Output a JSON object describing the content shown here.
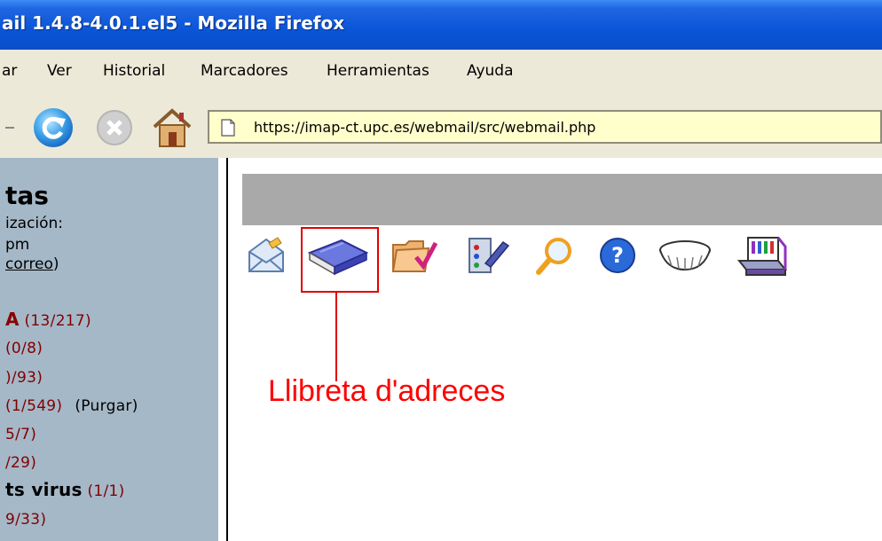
{
  "window": {
    "title": "ail 1.4.8-4.0.1.el5 - Mozilla Firefox"
  },
  "menu": {
    "items": [
      {
        "label": "ar"
      },
      {
        "label": "Ver"
      },
      {
        "label": "Historial"
      },
      {
        "label": "Marcadores"
      },
      {
        "label": "Herramientas"
      },
      {
        "label": "Ayuda"
      }
    ]
  },
  "toolbar": {
    "url": "https://imap-ct.upc.es/webmail/src/webmail.php",
    "icons": [
      "back-dropdown-icon",
      "reload-icon",
      "stop-icon",
      "home-icon",
      "page-icon"
    ]
  },
  "sidebar": {
    "title": "tas",
    "update_label": "ización:",
    "time": "pm",
    "check_mail_link": "correo",
    "folders": [
      {
        "name": "A",
        "count": "(13/217)"
      },
      {
        "name": "",
        "count": "(0/8)"
      },
      {
        "name": "",
        "count": ")/93)"
      },
      {
        "name": "",
        "count": "(1/549)",
        "purge": "(Purgar)"
      },
      {
        "name": "",
        "count": "5/7)"
      },
      {
        "name": "",
        "count": "/29)"
      },
      {
        "name": "ts virus",
        "count": "(1/1)"
      },
      {
        "name": "",
        "count": "9/33)"
      }
    ]
  },
  "main": {
    "icons": [
      "compose-icon",
      "address-book-icon",
      "folders-icon",
      "options-icon",
      "search-icon",
      "help-icon",
      "filters-icon",
      "calendar-icon"
    ],
    "annotation": "Llibreta d'adreces",
    "annotation_color": "#ff0000"
  }
}
